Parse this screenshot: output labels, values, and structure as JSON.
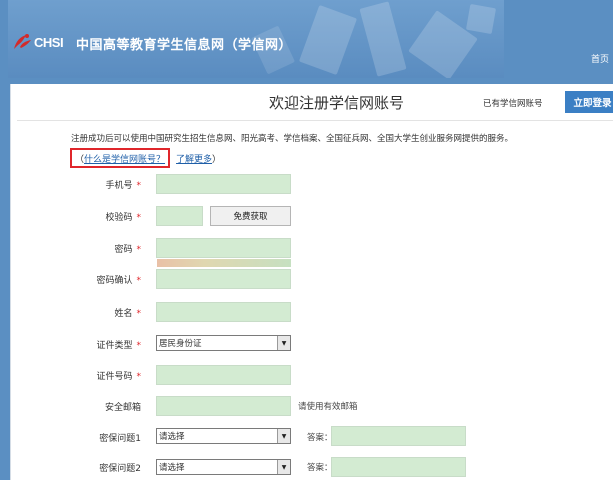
{
  "header": {
    "logo_text": "CHSI",
    "site_title": "中国高等教育学生信息网（学信网）",
    "home_link": "首页"
  },
  "panel": {
    "page_title": "欢迎注册学信网账号",
    "has_account": "已有学信网账号",
    "login_label": "立即登录"
  },
  "notice": {
    "text": "注册成功后可以使用中国研究生招生信息网、阳光高考、学信档案、全国征兵网、全国大学生创业服务网提供的服务。",
    "open_paren": "（",
    "what_is_link": "什么是学信网账号？",
    "learn_more_link": "了解更多",
    "close_paren": "）"
  },
  "form": {
    "required_mark": "*",
    "phone_label": "手机号",
    "code_label": "校验码",
    "get_code_label": "免费获取",
    "password_label": "密码",
    "password_confirm_label": "密码确认",
    "name_label": "姓名",
    "id_type_label": "证件类型",
    "id_type_value": "居民身份证",
    "id_number_label": "证件号码",
    "email_label": "安全邮箱",
    "email_hint": "请使用有效邮箱",
    "question1_label": "密保问题1",
    "question1_value": "请选择",
    "question2_label": "密保问题2",
    "question2_value": "请选择",
    "answer_label": "答案"
  },
  "colors": {
    "header_bg": "#5b8fc2",
    "field_bg": "#d3ebd2",
    "login_btn": "#3b7fc4",
    "required": "#e0262b",
    "highlight_box": "#e0262b",
    "link": "#1f5fa8"
  }
}
